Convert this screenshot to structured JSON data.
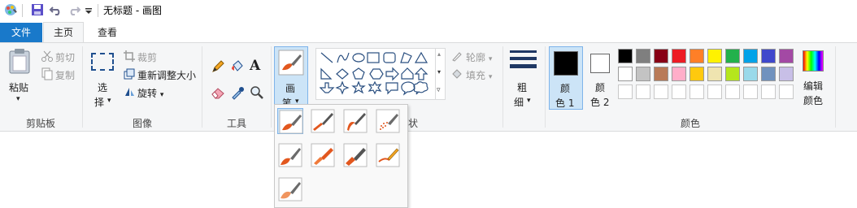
{
  "window": {
    "title": "无标题 - 画图"
  },
  "quick_access": [
    "save-icon",
    "undo-icon",
    "redo-icon",
    "customize-icon"
  ],
  "tabs": {
    "file": "文件",
    "home": "主页",
    "view": "查看"
  },
  "clipboard": {
    "paste": "粘贴",
    "cut": "剪切",
    "copy": "复制",
    "label": "剪贴板"
  },
  "image": {
    "select_top": "选",
    "select_bottom": "择",
    "crop": "裁剪",
    "resize": "重新调整大小",
    "rotate": "旋转",
    "label": "图像"
  },
  "tools": {
    "label": "工具"
  },
  "brushes": {
    "top": "画",
    "bottom": "笔"
  },
  "shapes": {
    "outline": "轮廓",
    "fill": "填充",
    "label_suffix": "状"
  },
  "size": {
    "top": "粗",
    "bottom": "细"
  },
  "colors": {
    "color1_top": "颜",
    "color1_bottom": "色 1",
    "color2_top": "颜",
    "color2_bottom": "色 2",
    "edit_top": "编辑",
    "edit_bottom": "颜色",
    "label": "颜色",
    "color1": "#000000",
    "color2": "#ffffff",
    "row1": [
      "#000000",
      "#7f7f7f",
      "#880015",
      "#ed1c24",
      "#ff7f27",
      "#fff200",
      "#22b14c",
      "#00a2e8",
      "#3f48cc",
      "#a349a4"
    ],
    "row2": [
      "#ffffff",
      "#c3c3c3",
      "#b97a57",
      "#ffaec9",
      "#ffc90e",
      "#efe4b0",
      "#b5e61d",
      "#99d9ea",
      "#7092be",
      "#c8bfe7"
    ]
  }
}
